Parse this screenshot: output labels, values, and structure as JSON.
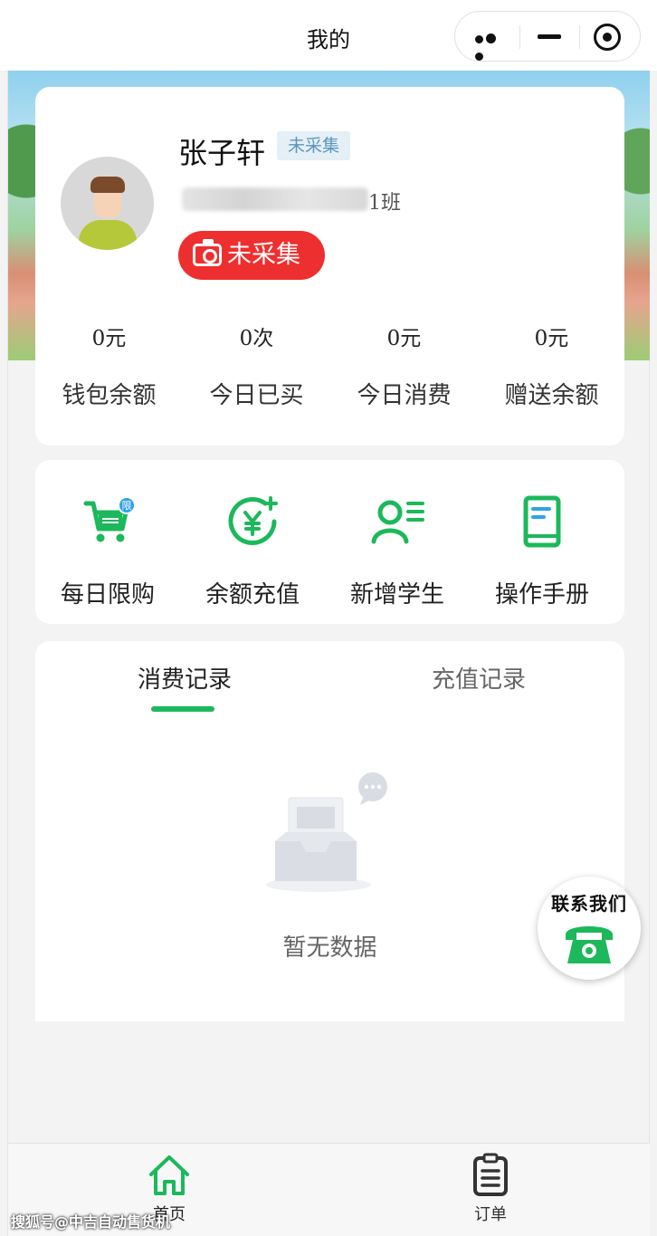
{
  "navbar": {
    "title": "我的"
  },
  "profile": {
    "name": "张子轩",
    "face_tag": "未采集",
    "class_suffix": "1班",
    "collect_button": "未采集"
  },
  "stats": [
    {
      "value": "0元",
      "label": "钱包余额"
    },
    {
      "value": "0次",
      "label": "今日已买"
    },
    {
      "value": "0元",
      "label": "今日消费"
    },
    {
      "value": "0元",
      "label": "赠送余额"
    }
  ],
  "actions": [
    {
      "label": "每日限购",
      "icon": "limited-cart-icon",
      "badge": "限"
    },
    {
      "label": "余额充值",
      "icon": "yuan-recharge-icon"
    },
    {
      "label": "新增学生",
      "icon": "add-student-icon"
    },
    {
      "label": "操作手册",
      "icon": "manual-book-icon"
    }
  ],
  "records": {
    "tabs": [
      "消费记录",
      "充值记录"
    ],
    "active_tab": 0,
    "empty_text": "暂无数据"
  },
  "contact": {
    "label": "联系我们",
    "icon": "telephone-icon"
  },
  "tabbar": [
    {
      "label": "首页",
      "icon": "home-icon",
      "active": true
    },
    {
      "label": "订单",
      "icon": "order-list-icon",
      "active": false
    }
  ],
  "watermark": "搜狐号@中吉自动售货机",
  "colors": {
    "accent_green": "#1cb85b",
    "danger_red": "#ee2f2f",
    "tag_blue": "#5a95c0"
  }
}
